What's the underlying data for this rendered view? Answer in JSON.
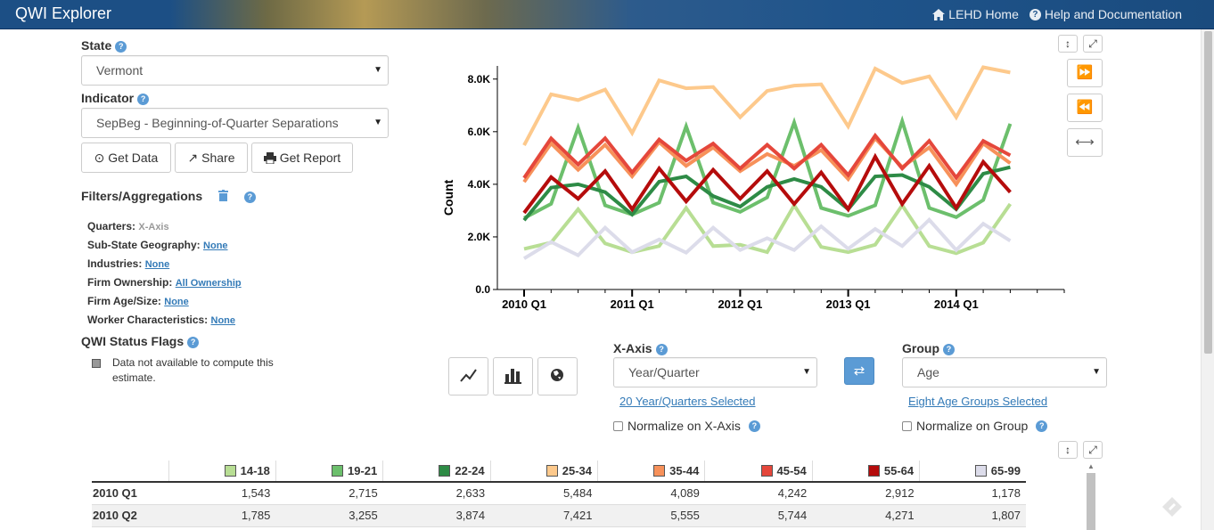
{
  "header": {
    "title": "QWI Explorer",
    "nav": [
      {
        "icon": "home-icon",
        "label": "LEHD Home"
      },
      {
        "icon": "question-circle-icon",
        "label": "Help and Documentation"
      }
    ]
  },
  "left": {
    "state_label": "State",
    "state_value": "Vermont",
    "indicator_label": "Indicator",
    "indicator_value": "SepBeg - Beginning-of-Quarter Separations",
    "buttons": {
      "get_data": "Get Data",
      "share": "Share",
      "get_report": "Get Report"
    },
    "filters_title": "Filters/Aggregations",
    "filters": [
      {
        "label": "Quarters:",
        "value": "X-Axis",
        "link": false
      },
      {
        "label": "Sub-State Geography:",
        "value": "None",
        "link": true
      },
      {
        "label": "Industries:",
        "value": "None",
        "link": true
      },
      {
        "label": "Firm Ownership:",
        "value": "All Ownership",
        "link": true
      },
      {
        "label": "Firm Age/Size:",
        "value": "None",
        "link": true
      },
      {
        "label": "Worker Characteristics:",
        "value": "None",
        "link": true
      }
    ],
    "status_title": "QWI Status Flags",
    "status_flag_text": "Data not available to compute this estimate."
  },
  "controls": {
    "xaxis_label": "X-Axis",
    "xaxis_value": "Year/Quarter",
    "xaxis_link": "20 Year/Quarters Selected",
    "normalize_x": "Normalize on X-Axis",
    "group_label": "Group",
    "group_value": "Age",
    "group_link": "Eight Age Groups Selected",
    "normalize_group": "Normalize on Group"
  },
  "chart_data": {
    "type": "line",
    "ylabel": "Count",
    "ylim": [
      0,
      8500
    ],
    "yticks": [
      "0.0",
      "2.0K",
      "4.0K",
      "6.0K",
      "8.0K"
    ],
    "ytick_values": [
      0,
      2000,
      4000,
      6000,
      8000
    ],
    "x": [
      "2010 Q1",
      "2010 Q2",
      "2010 Q3",
      "2010 Q4",
      "2011 Q1",
      "2011 Q2",
      "2011 Q3",
      "2011 Q4",
      "2012 Q1",
      "2012 Q2",
      "2012 Q3",
      "2012 Q4",
      "2013 Q1",
      "2013 Q2",
      "2013 Q3",
      "2013 Q4",
      "2014 Q1",
      "2014 Q2",
      "2014 Q3",
      "2014 Q4"
    ],
    "xtick_labels": [
      "2010 Q1",
      "2011 Q1",
      "2012 Q1",
      "2013 Q1",
      "2014 Q1"
    ],
    "grid": false,
    "legend": "none",
    "series": [
      {
        "name": "14-18",
        "color": "#b8de94",
        "values": [
          1543,
          1785,
          3050,
          1750,
          1420,
          1650,
          3100,
          1650,
          1700,
          1420,
          3200,
          1620,
          1420,
          1700,
          3200,
          1650,
          1380,
          1780,
          3250,
          null
        ]
      },
      {
        "name": "19-21",
        "color": "#6cbf6c",
        "values": [
          2715,
          3255,
          6150,
          3200,
          2850,
          3300,
          6200,
          3300,
          2950,
          3500,
          6350,
          3100,
          2800,
          3200,
          6400,
          3100,
          2750,
          3400,
          6300,
          null
        ]
      },
      {
        "name": "22-24",
        "color": "#2e8b46",
        "values": [
          2633,
          3874,
          4000,
          3700,
          2850,
          4100,
          4300,
          3550,
          3150,
          3900,
          4200,
          3900,
          3050,
          4300,
          4350,
          3900,
          3050,
          4400,
          4650,
          null
        ]
      },
      {
        "name": "25-34",
        "color": "#fdc98c",
        "values": [
          5484,
          7421,
          7200,
          7600,
          5950,
          7950,
          7650,
          7700,
          6550,
          7550,
          7750,
          7800,
          6200,
          8400,
          7850,
          8100,
          6550,
          8450,
          8250,
          null
        ]
      },
      {
        "name": "35-44",
        "color": "#f7915a",
        "values": [
          4089,
          5555,
          4550,
          5500,
          4300,
          5600,
          4700,
          5400,
          4500,
          5150,
          4700,
          5300,
          4200,
          5750,
          4650,
          5400,
          4000,
          5550,
          4800,
          null
        ]
      },
      {
        "name": "45-54",
        "color": "#e5473b",
        "values": [
          4242,
          5744,
          4750,
          5750,
          4450,
          5700,
          4900,
          5550,
          4600,
          5500,
          4600,
          5500,
          4350,
          5850,
          4600,
          5650,
          4250,
          5650,
          5100,
          null
        ]
      },
      {
        "name": "55-64",
        "color": "#b50c0c",
        "values": [
          2912,
          4271,
          3450,
          4500,
          3050,
          4600,
          3350,
          4550,
          3450,
          4500,
          3250,
          4450,
          3050,
          5050,
          3250,
          4700,
          3100,
          4850,
          3700,
          null
        ]
      },
      {
        "name": "65-99",
        "color": "#dcdcea",
        "values": [
          1178,
          1807,
          1300,
          2350,
          1420,
          1900,
          1400,
          2350,
          1500,
          1950,
          1500,
          2400,
          1550,
          2300,
          1650,
          2650,
          1500,
          2500,
          1850,
          null
        ]
      }
    ]
  },
  "table": {
    "columns": [
      "14-18",
      "19-21",
      "22-24",
      "25-34",
      "35-44",
      "45-54",
      "55-64",
      "65-99"
    ],
    "column_colors": [
      "#b8de94",
      "#6cbf6c",
      "#2e8b46",
      "#fdc98c",
      "#f7915a",
      "#e5473b",
      "#b50c0c",
      "#dcdcea"
    ],
    "rows": [
      {
        "label": "2010 Q1",
        "values": [
          "1,543",
          "2,715",
          "2,633",
          "5,484",
          "4,089",
          "4,242",
          "2,912",
          "1,178"
        ]
      },
      {
        "label": "2010 Q2",
        "values": [
          "1,785",
          "3,255",
          "3,874",
          "7,421",
          "5,555",
          "5,744",
          "4,271",
          "1,807"
        ]
      }
    ]
  }
}
